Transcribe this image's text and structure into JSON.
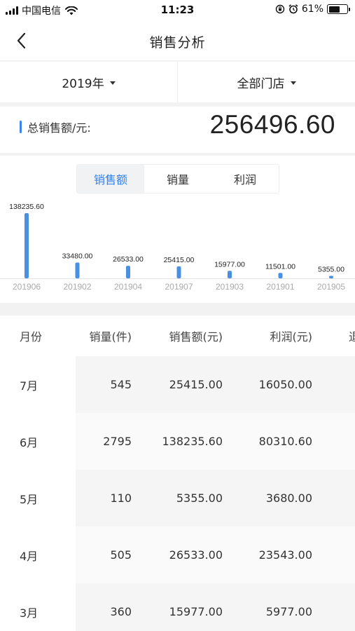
{
  "status_bar": {
    "carrier": "中国电信",
    "time": "11:23",
    "battery_percent": "61%",
    "battery_level": 0.61
  },
  "nav": {
    "title": "销售分析",
    "back_icon": "chevron-left-icon"
  },
  "filters": {
    "year": "2019年",
    "store": "全部门店"
  },
  "total": {
    "label": "总销售额/元:",
    "value": "256496.60"
  },
  "accent_color": "#4a90e2",
  "tabs": {
    "items": [
      "销售额",
      "销量",
      "利润"
    ],
    "active": 0
  },
  "chart_data": {
    "type": "bar",
    "categories": [
      "201906",
      "201902",
      "201904",
      "201907",
      "201903",
      "201901",
      "201905"
    ],
    "values": [
      138235.6,
      33480.0,
      26533.0,
      25415.0,
      15977.0,
      11501.0,
      5355.0
    ],
    "value_labels": [
      "138235.60",
      "33480.00",
      "26533.00",
      "25415.00",
      "15977.00",
      "11501.00",
      "5355.00"
    ],
    "ylim": [
      0,
      138235.6
    ],
    "color": "#4a90e2"
  },
  "table": {
    "headers": {
      "month": "月份",
      "qty": "销量(件)",
      "sales": "销售额(元)",
      "profit": "利润(元)",
      "more": "退"
    },
    "rows": [
      {
        "month": "7月",
        "qty": "545",
        "sales": "25415.00",
        "profit": "16050.00"
      },
      {
        "month": "6月",
        "qty": "2795",
        "sales": "138235.60",
        "profit": "80310.60"
      },
      {
        "month": "5月",
        "qty": "110",
        "sales": "5355.00",
        "profit": "3680.00"
      },
      {
        "month": "4月",
        "qty": "505",
        "sales": "26533.00",
        "profit": "23543.00"
      },
      {
        "month": "3月",
        "qty": "360",
        "sales": "15977.00",
        "profit": "5977.00"
      }
    ]
  }
}
